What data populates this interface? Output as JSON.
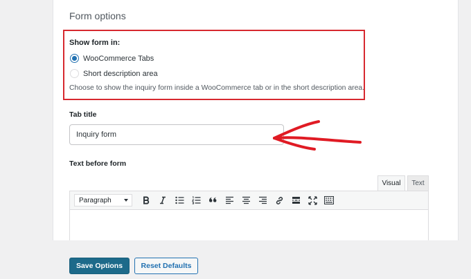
{
  "section": {
    "title": "Form options"
  },
  "show_form": {
    "label": "Show form in:",
    "options": [
      {
        "label": "WooCommerce Tabs",
        "selected": true
      },
      {
        "label": "Short description area",
        "selected": false
      }
    ],
    "description": "Choose to show the inquiry form inside a WooCommerce tab or in the short description area."
  },
  "tab_title": {
    "label": "Tab title",
    "value": "Inquiry form"
  },
  "text_before_form": {
    "label": "Text before form",
    "tabs": [
      "Visual",
      "Text"
    ],
    "format_select": "Paragraph",
    "toolbar_icons": [
      "bold-icon",
      "italic-icon",
      "bullet-list-icon",
      "numbered-list-icon",
      "blockquote-icon",
      "align-left-icon",
      "align-center-icon",
      "align-right-icon",
      "link-icon",
      "read-more-icon",
      "fullscreen-icon",
      "toolbar-toggle-icon"
    ]
  },
  "actions": {
    "save": "Save Options",
    "reset": "Reset Defaults"
  },
  "colors": {
    "accent": "#2271b1",
    "highlight": "#d7282f",
    "primary_button": "#1d6a8a"
  }
}
